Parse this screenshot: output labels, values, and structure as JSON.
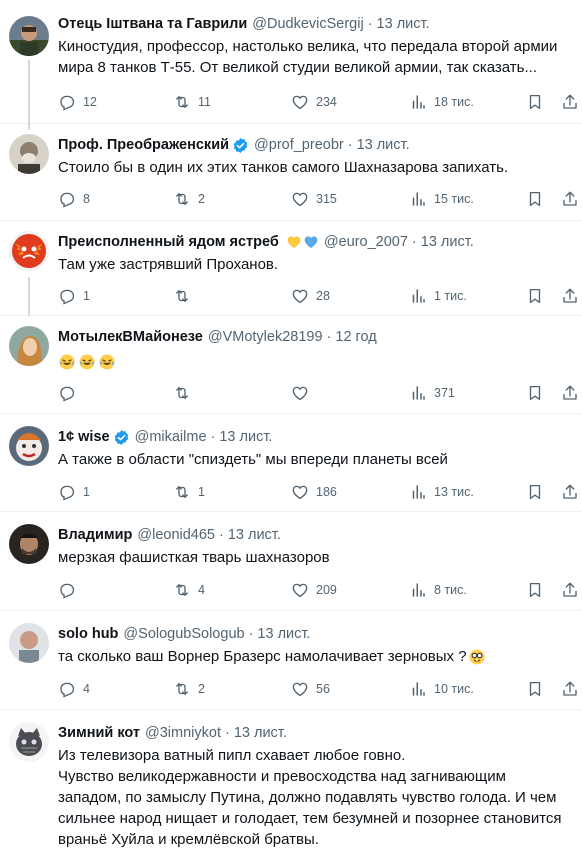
{
  "tweets": [
    {
      "name": "Отець Іштвана та Гаврили",
      "handle": "@DudkevicSergij",
      "time": "13 лист.",
      "text": "Киностудия, профессор, настолько велика, что передала второй армии мира 8 танков Т-55. От великой студии великой армии, так сказать...",
      "replies": "12",
      "retweets": "11",
      "likes": "234",
      "views": "18 тис."
    },
    {
      "name": "Проф. Преображенский",
      "handle": "@prof_preobr",
      "time": "13 лист.",
      "text": "Стоило бы в один их этих танков самого Шахназарова запихать.",
      "replies": "8",
      "retweets": "2",
      "likes": "315",
      "views": "15 тис."
    },
    {
      "name": "Преисполненный ядом ястреб",
      "handle": "@euro_2007",
      "time": "13 лист.",
      "text": "Там уже застрявший Проханов.",
      "replies": "1",
      "retweets": "",
      "likes": "28",
      "views": "1 тис."
    },
    {
      "name": "МотылекВМайонезе",
      "handle": "@VMotylek28199",
      "time": "12 год",
      "text": "",
      "replies": "",
      "retweets": "",
      "likes": "",
      "views": "371"
    },
    {
      "name": "1¢ wise",
      "handle": "@mikailme",
      "time": "13 лист.",
      "text": "А также в области \"спиздеть\" мы впереди планеты всей",
      "replies": "1",
      "retweets": "1",
      "likes": "186",
      "views": "13 тис."
    },
    {
      "name": "Владимир",
      "handle": "@leonid465",
      "time": "13 лист.",
      "text": "мерзкая фашисткая тварь шахназоров",
      "replies": "",
      "retweets": "4",
      "likes": "209",
      "views": "8 тис."
    },
    {
      "name": "solo hub",
      "handle": "@SologubSologub",
      "time": "13 лист.",
      "text": "та сколько ваш Ворнер Бразерс намолачивает зерновых ?",
      "replies": "4",
      "retweets": "2",
      "likes": "56",
      "views": "10 тис."
    },
    {
      "name": "Зимний кот",
      "handle": "@3imniykot",
      "time": "13 лист.",
      "text": "Из телевизора ватный пипл схавает любое говно.\nЧувство великодержавности и превосходства над загнивающим западом, по замыслу Путина, должно подавлять чувство голода. И чем сильнее народ нищает и голодает, тем безумней и позорнее становится враньё Хуйла и кремлёвской братвы."
    }
  ]
}
